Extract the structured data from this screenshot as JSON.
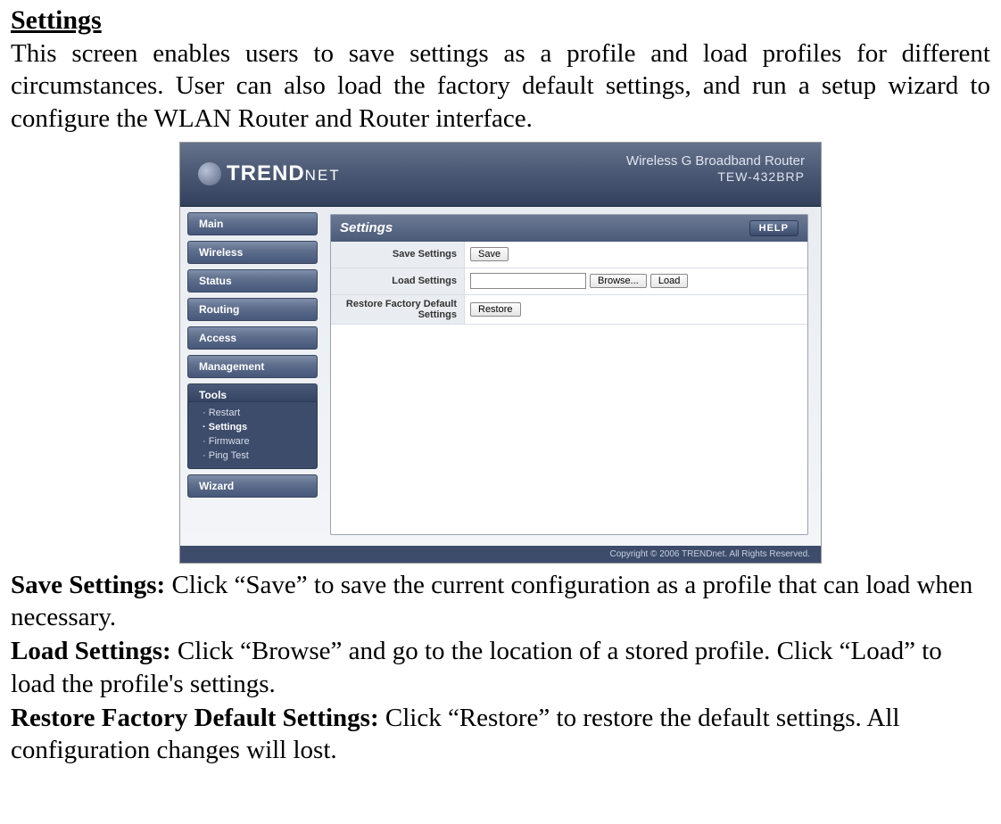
{
  "doc": {
    "heading": "Settings",
    "intro": "This screen enables users to save settings as a profile and load profiles for different circumstances. User can also load the factory default settings, and run a setup wizard to configure the WLAN Router and Router interface.",
    "save_label": "Save Settings:",
    "save_text": " Click “Save” to save the current configuration as a profile that can load when necessary.",
    "load_label": "Load Settings:",
    "load_text": " Click “Browse” and go to the location of a stored profile. Click “Load” to load the profile's settings.",
    "restore_label": "Restore Factory Default Settings:",
    "restore_text": " Click “Restore” to restore the default settings. All configuration changes will lost."
  },
  "header": {
    "brand_main": "TREND",
    "brand_sub": "NET",
    "tagline": "Wireless G Broadband Router",
    "model": "TEW-432BRP"
  },
  "sidebar": {
    "items": [
      "Main",
      "Wireless",
      "Status",
      "Routing",
      "Access",
      "Management"
    ],
    "tools": "Tools",
    "subs": [
      "Restart",
      "Settings",
      "Firmware",
      "Ping Test"
    ],
    "wizard": "Wizard"
  },
  "panel": {
    "title": "Settings",
    "help": "HELP",
    "rows": {
      "save_label": "Save Settings",
      "save_btn": "Save",
      "load_label": "Load Settings",
      "browse_btn": "Browse...",
      "load_btn": "Load",
      "restore_label": "Restore Factory Default Settings",
      "restore_btn": "Restore"
    }
  },
  "footer": "Copyright © 2006 TRENDnet. All Rights Reserved."
}
